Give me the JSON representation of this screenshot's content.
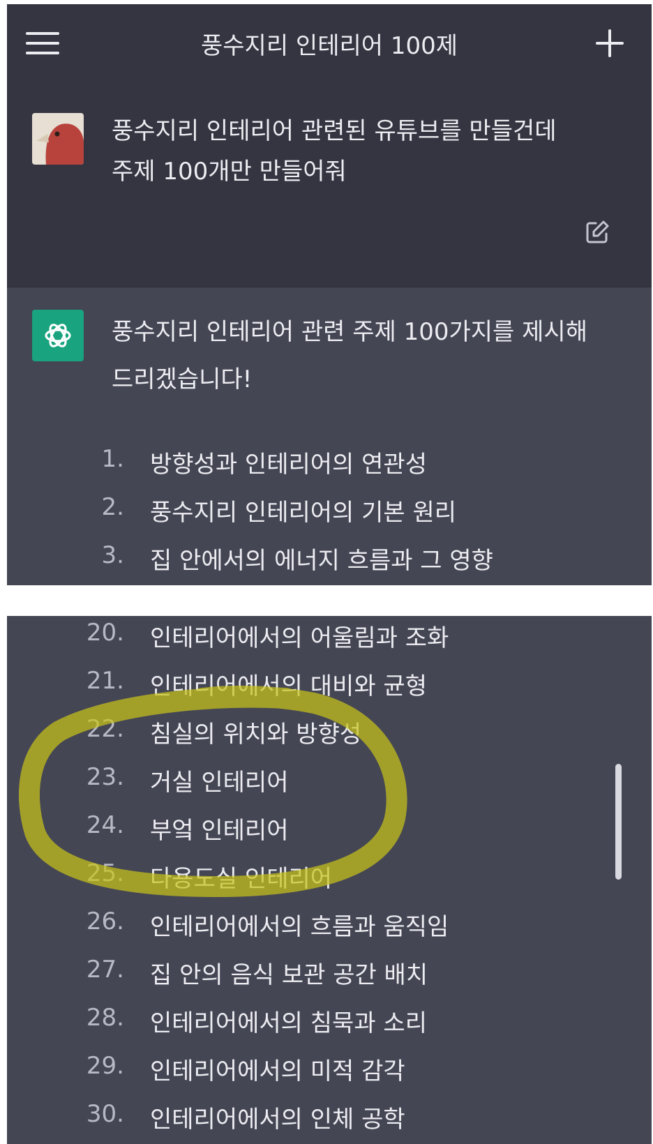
{
  "header": {
    "title": "풍수지리 인테리어 100제"
  },
  "user_message": {
    "text": "풍수지리 인테리어 관련된 유튜브를 만들건데\n주제 100개만 만들어줘"
  },
  "assistant": {
    "intro": "풍수지리 인테리어 관련 주제 100가지를 제시해\n드리겠습니다!",
    "topics_top": [
      {
        "num": "1.",
        "text": "방향성과 인테리어의 연관성"
      },
      {
        "num": "2.",
        "text": "풍수지리 인테리어의 기본 원리"
      },
      {
        "num": "3.",
        "text": "집 안에서의 에너지 흐름과 그 영향"
      }
    ],
    "topics_bottom": [
      {
        "num": "20.",
        "text": "인테리어에서의 어울림과 조화"
      },
      {
        "num": "21.",
        "text": "인테리어에서의 대비와 균형"
      },
      {
        "num": "22.",
        "text": "침실의 위치와 방향성"
      },
      {
        "num": "23.",
        "text": "거실 인테리어"
      },
      {
        "num": "24.",
        "text": "부엌 인테리어"
      },
      {
        "num": "25.",
        "text": "다용도실 인테리어"
      },
      {
        "num": "26.",
        "text": "인테리어에서의 흐름과 움직임"
      },
      {
        "num": "27.",
        "text": "집 안의 음식 보관 공간 배치"
      },
      {
        "num": "28.",
        "text": "인테리어에서의 침묵과 소리"
      },
      {
        "num": "29.",
        "text": "인테리어에서의 미적 감각"
      },
      {
        "num": "30.",
        "text": "인테리어에서의 인체 공학"
      }
    ]
  },
  "colors": {
    "header_bg": "#343541",
    "assistant_bg": "#444654",
    "gpt_green": "#19a37f",
    "highlight": "#c8c41a"
  },
  "icons": [
    "menu-icon",
    "plus-icon",
    "avatar",
    "edit-icon",
    "chatgpt-logo-icon"
  ]
}
